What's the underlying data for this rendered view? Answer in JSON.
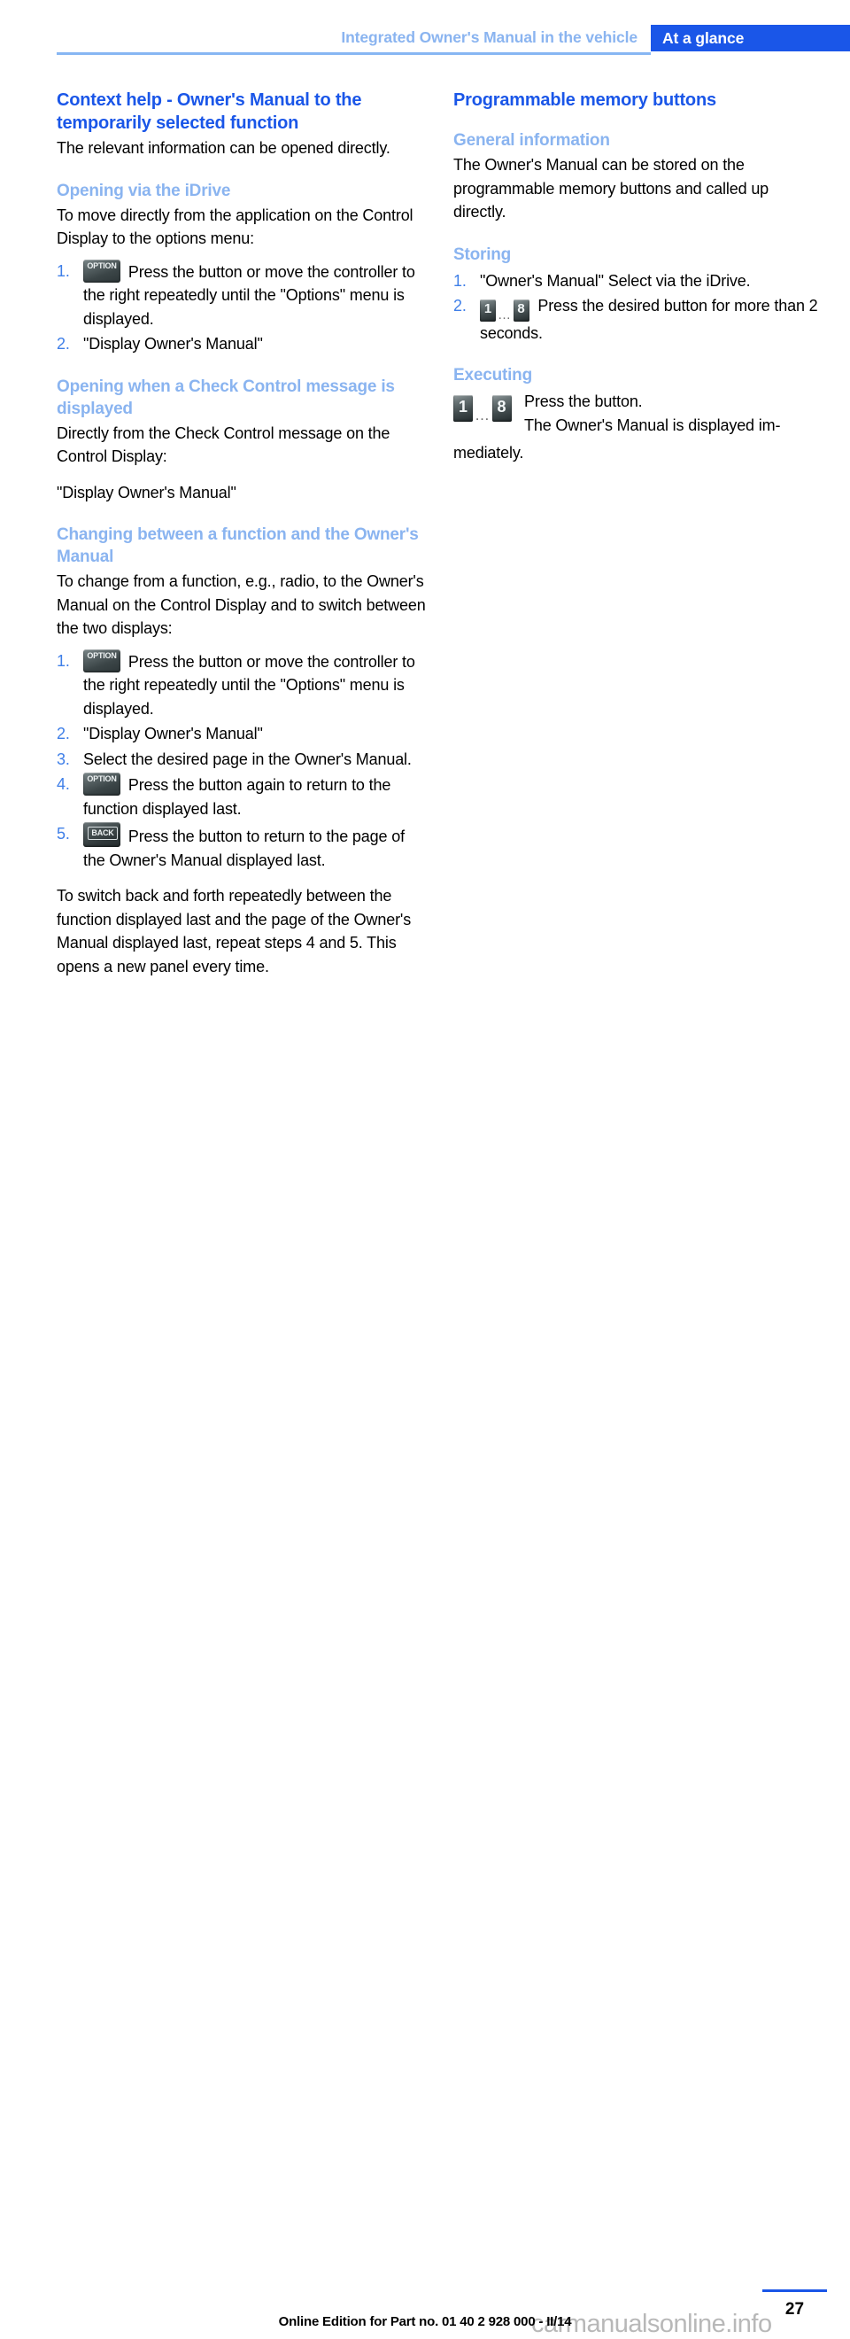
{
  "header": {
    "chapter": "Integrated Owner's Manual in the vehicle",
    "section": "At a glance"
  },
  "left_column": {
    "title": "Context help - Owner's Manual to the temporarily selected function",
    "intro": "The relevant information can be opened directly.",
    "sub1": {
      "title": "Opening via the iDrive",
      "lead": "To move directly from the application on the Control Display to the options menu:",
      "steps": [
        {
          "num": "1.",
          "icon": "option-button-icon",
          "icon_label": "OPTION",
          "text": "Press the button or move the controller to the right repeatedly until the \"Options\" menu is displayed."
        },
        {
          "num": "2.",
          "icon": null,
          "text": "\"Display Owner's Manual\""
        }
      ]
    },
    "sub2": {
      "title": "Opening when a Check Control message is displayed",
      "lead": "Directly from the Check Control message on the Control Display:",
      "command": "\"Display Owner's Manual\""
    },
    "sub3": {
      "title": "Changing between a function and the Owner's Manual",
      "lead": "To change from a function, e.g., radio, to the Owner's Manual on the Control Display and to switch between the two displays:",
      "steps": [
        {
          "num": "1.",
          "icon": "option-button-icon",
          "icon_label": "OPTION",
          "text": "Press the button or move the controller to the right repeatedly until the \"Options\" menu is displayed."
        },
        {
          "num": "2.",
          "icon": null,
          "text": "\"Display Owner's Manual\""
        },
        {
          "num": "3.",
          "icon": null,
          "text": "Select the desired page in the Owner's Manual."
        },
        {
          "num": "4.",
          "icon": "option-button-icon",
          "icon_label": "OPTION",
          "text": "Press the button again to return to the function displayed last."
        },
        {
          "num": "5.",
          "icon": "back-button-icon",
          "icon_label": "BACK",
          "text": "Press the button to return to the page of the Owner's Manual displayed last."
        }
      ],
      "outro": "To switch back and forth repeatedly between the function displayed last and the page of the Owner's Manual displayed last, repeat steps 4 and 5. This opens a new panel every time."
    }
  },
  "right_column": {
    "title": "Programmable memory buttons",
    "sub1": {
      "title": "General information",
      "body": "The Owner's Manual can be stored on the programmable memory buttons and called up directly."
    },
    "sub2": {
      "title": "Storing",
      "steps": [
        {
          "num": "1.",
          "icon": null,
          "text": "\"Owner's Manual\" Select via the iDrive."
        },
        {
          "num": "2.",
          "icon": "memory-buttons-icon",
          "key_first": "1",
          "key_dots": "…",
          "key_last": "8",
          "text": "Press the desired button for more than 2 seconds."
        }
      ]
    },
    "sub3": {
      "title": "Executing",
      "key_first": "1",
      "key_dots": "…",
      "key_last": "8",
      "line1": "Press the button.",
      "line2": "The Owner's Manual is displayed im-",
      "line3": "mediately."
    }
  },
  "footer": {
    "page_number": "27",
    "online_edition": "Online Edition for Part no. 01 40 2 928 000 - II/14",
    "watermark": "carmanualsonline.info"
  },
  "colors": {
    "accent_blue": "#1a56e8",
    "light_blue": "#8ab4f0",
    "rule_blue": "#87b6f3",
    "number_blue": "#3f7fe8"
  }
}
